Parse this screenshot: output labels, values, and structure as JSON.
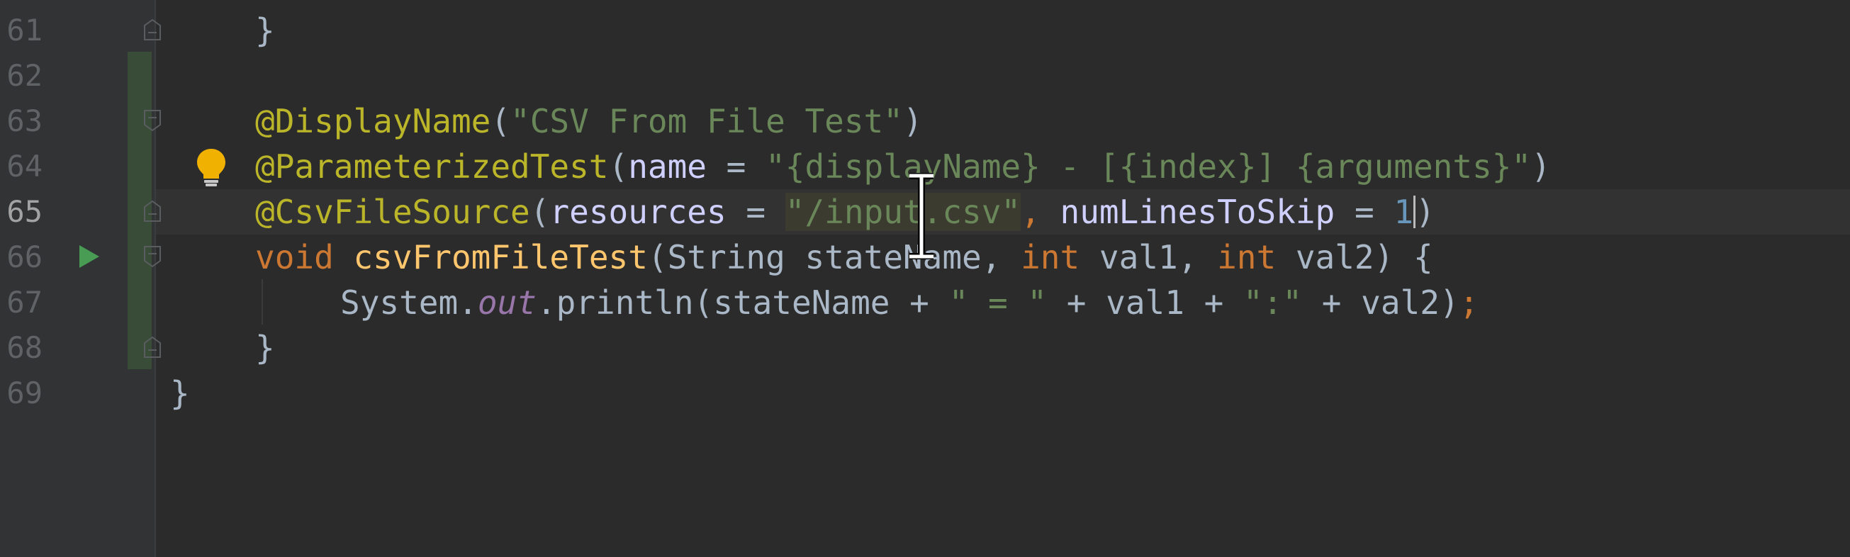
{
  "editor": {
    "colors": {
      "background": "#2b2b2b",
      "gutter": "#313335",
      "annotation": "#bbb529",
      "string": "#6a8759",
      "keyword": "#cc7832",
      "number": "#6897bb",
      "method": "#ffc66d",
      "field": "#9876aa",
      "default_text": "#a9b7c6",
      "run_icon": "#499c54",
      "bulb_icon": "#f0b100"
    },
    "lines": [
      {
        "number": "61",
        "tokens": [
          "}"
        ]
      },
      {
        "number": "62",
        "tokens": []
      },
      {
        "number": "63",
        "tokens": [
          "@DisplayName",
          "(",
          "\"CSV From File Test\"",
          ")"
        ]
      },
      {
        "number": "64",
        "tokens": [
          "@ParameterizedTest",
          "(",
          "name",
          " = ",
          "\"{displayName} - [{index}] {arguments}\"",
          ")"
        ]
      },
      {
        "number": "65",
        "tokens": [
          "@CsvFileSource",
          "(",
          "resources",
          " = ",
          "\"/input.csv\"",
          ", ",
          "numLinesToSkip",
          " = ",
          "1",
          ")"
        ]
      },
      {
        "number": "66",
        "tokens": [
          "void ",
          "csvFromFileTest",
          "(String stateName, ",
          "int ",
          "val1, ",
          "int ",
          "val2) {"
        ]
      },
      {
        "number": "67",
        "tokens": [
          "System.",
          "out",
          ".println(stateName + ",
          "\" = \"",
          " + val1 + ",
          "\":\"",
          " + val2)",
          ";"
        ]
      },
      {
        "number": "68",
        "tokens": [
          "}"
        ]
      },
      {
        "number": "69",
        "tokens": [
          "}"
        ]
      }
    ],
    "active_line": "65",
    "icons": {
      "run": "run-gutter-icon",
      "bulb": "intention-bulb-icon",
      "fold": "fold-marker-icon",
      "cursor": "text-cursor-icon"
    }
  }
}
